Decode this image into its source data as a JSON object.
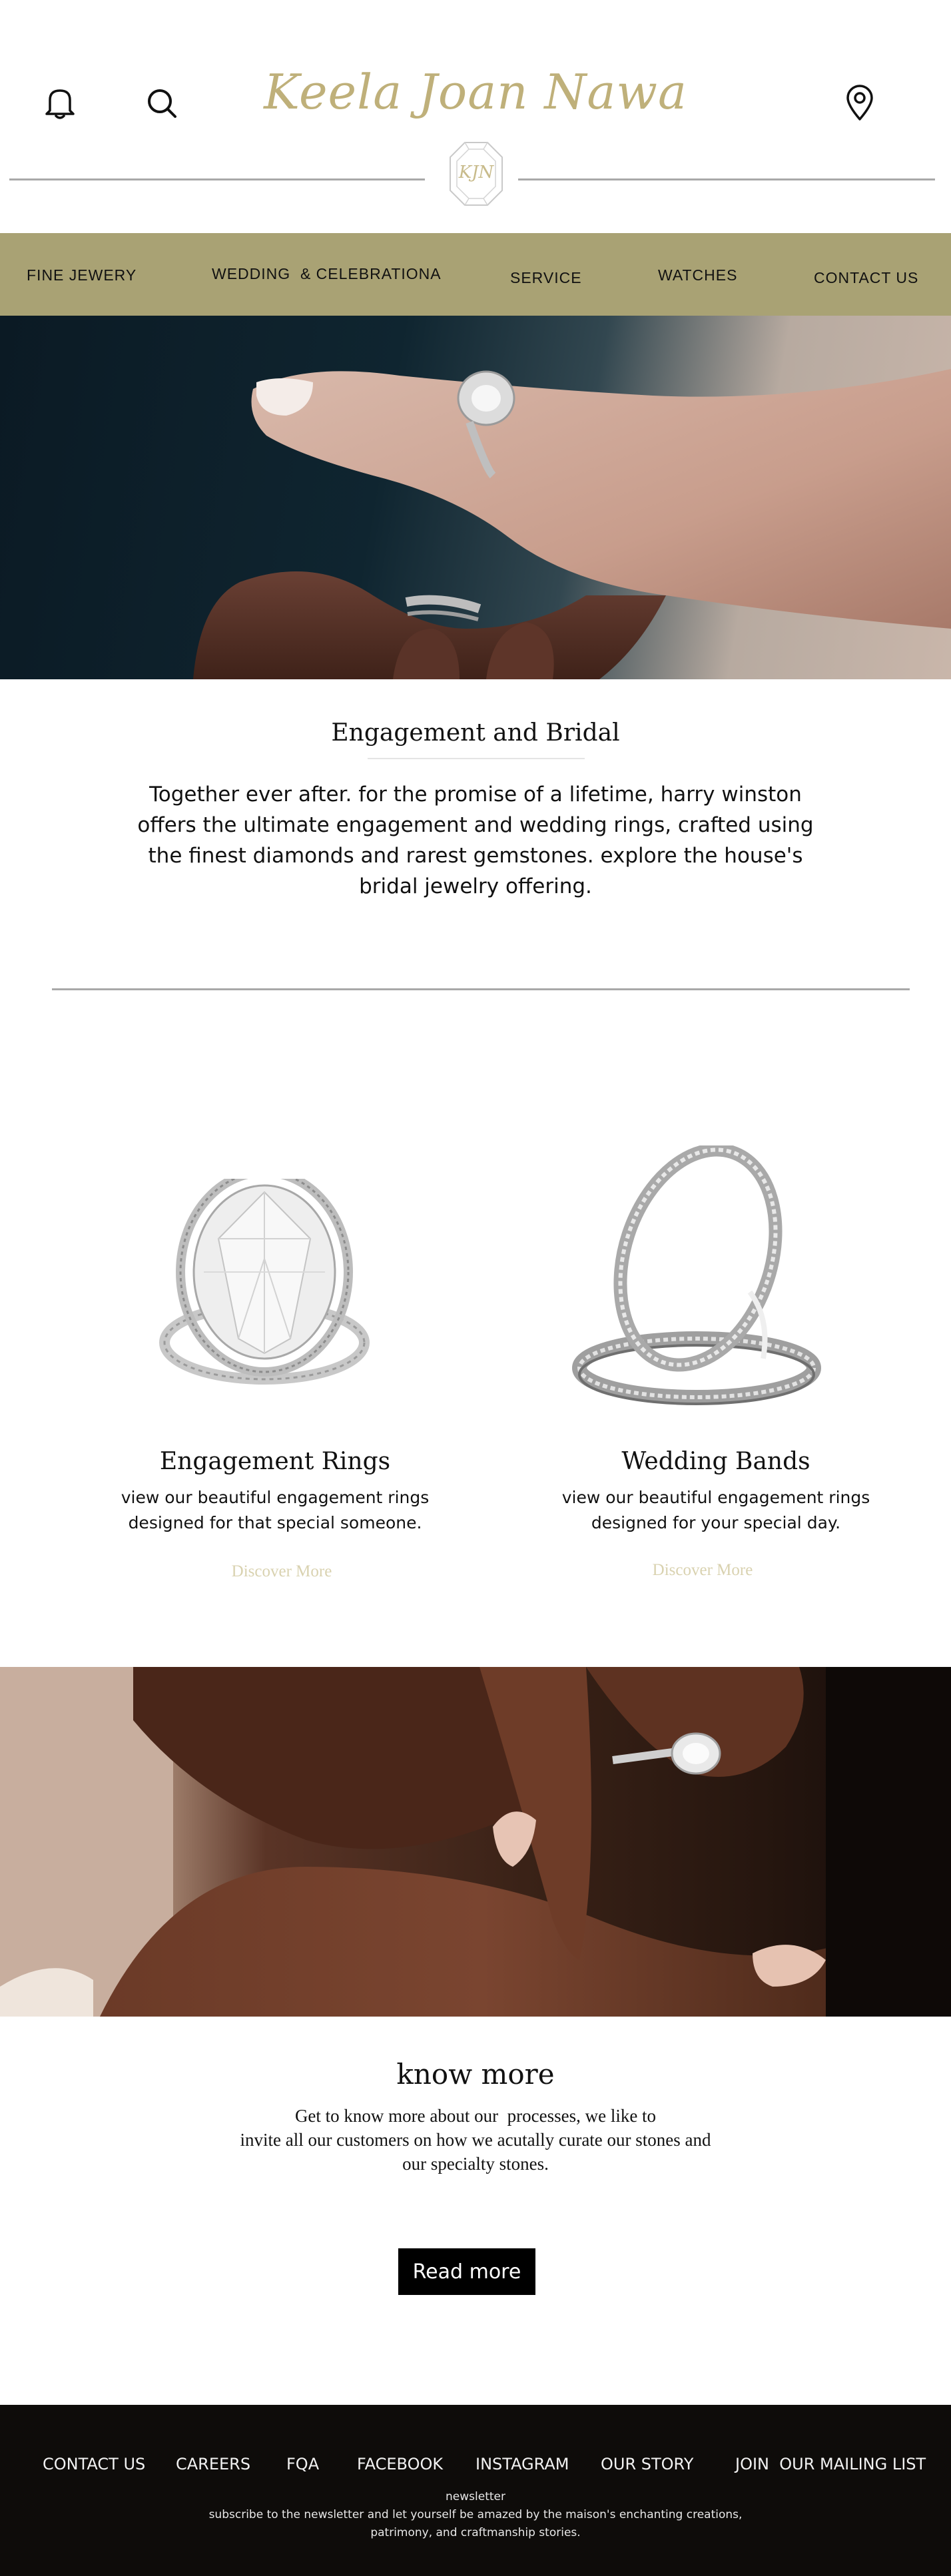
{
  "header": {
    "brand": "Keela Joan Nawa",
    "monogram": "KJN",
    "icons": [
      "bell-icon",
      "search-icon",
      "location-pin-icon"
    ]
  },
  "nav": {
    "items": [
      "FINE JEWERY",
      "WEDDING  & CELEBRATIONA",
      "SERVICE",
      "WATCHES",
      "CONTACT US"
    ]
  },
  "intro": {
    "title": "Engagement and Bridal",
    "text": "Together ever after. for the promise of a lifetime, harry winston offers the ultimate engagement and wedding rings, crafted using the finest diamonds and rarest gemstones. explore the house's bridal jewelry offering."
  },
  "products": [
    {
      "title": "Engagement Rings",
      "desc_line1": "view our beautiful engagement rings",
      "desc_line2": "designed for that special someone.",
      "cta": "Discover More"
    },
    {
      "title": "Wedding Bands",
      "desc_line1": "view our beautiful engagement rings",
      "desc_line2": "designed for your special day.",
      "cta": "Discover More"
    }
  ],
  "know_more": {
    "title": "know more",
    "line1": "Get to know more about our  processes, we like to",
    "line2": "invite all our customers on how we acutally curate our stones and",
    "line3": "our specialty stones.",
    "button": "Read more"
  },
  "footer": {
    "links": [
      "CONTACT US",
      "CAREERS",
      "FQA",
      "FACEBOOK",
      "INSTAGRAM",
      "OUR STORY",
      "JOIN  OUR MAILING LIST"
    ],
    "newsletter_label": "newsletter",
    "newsletter_line1": "subscribe to the newsletter and let yourself be amazed by the maison's enchanting creations,",
    "newsletter_line2": "patrimony, and craftmanship stories."
  },
  "colors": {
    "nav_bg": "#a9a274",
    "brand_gold": "#bfb07a",
    "cta_muted": "#d9d2b0",
    "footer_bg": "#0e0c0a"
  }
}
